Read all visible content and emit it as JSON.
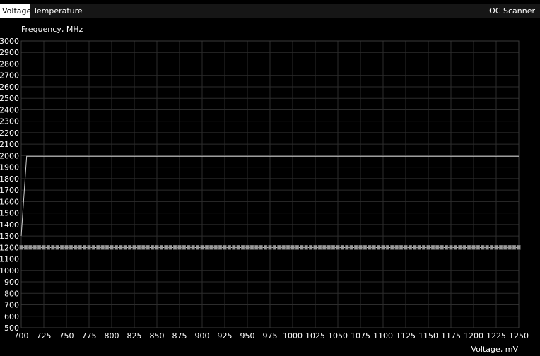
{
  "tabs": [
    {
      "label": "Voltage",
      "active": true
    },
    {
      "label": "Temperature",
      "active": false
    }
  ],
  "oc_scanner_label": "OC Scanner",
  "colors": {
    "background": "#000000",
    "grid": "#2c2c2c",
    "curve": "#cfcfcf",
    "marker": "#9a9a9a"
  },
  "chart_data": {
    "type": "line",
    "ylabel": "Frequency, MHz",
    "xlabel": "Voltage, mV",
    "xlim": [
      700,
      1250
    ],
    "ylim": [
      500,
      3000
    ],
    "x_ticks": [
      700,
      725,
      750,
      775,
      800,
      825,
      850,
      875,
      900,
      925,
      950,
      975,
      1000,
      1025,
      1050,
      1075,
      1100,
      1125,
      1150,
      1175,
      1200,
      1225,
      1250
    ],
    "y_ticks": [
      500,
      600,
      700,
      800,
      900,
      1000,
      1100,
      1200,
      1300,
      1400,
      1500,
      1600,
      1700,
      1800,
      1900,
      2000,
      2100,
      2200,
      2300,
      2400,
      2500,
      2600,
      2700,
      2800,
      2900,
      3000
    ],
    "grid": true,
    "series": [
      {
        "x": [
          700,
          706,
          1250
        ],
        "y": [
          1300,
          1995,
          1995
        ]
      },
      {
        "x": [
          700,
          705,
          710,
          715,
          720,
          725,
          730,
          735,
          740,
          745,
          750,
          755,
          760,
          765,
          770,
          775,
          780,
          785,
          790,
          795,
          800,
          805,
          810,
          815,
          820,
          825,
          830,
          835,
          840,
          845,
          850,
          855,
          860,
          865,
          870,
          875,
          880,
          885,
          890,
          895,
          900,
          905,
          910,
          915,
          920,
          925,
          930,
          935,
          940,
          945,
          950,
          955,
          960,
          965,
          970,
          975,
          980,
          985,
          990,
          995,
          1000,
          1005,
          1010,
          1015,
          1020,
          1025,
          1030,
          1035,
          1040,
          1045,
          1050,
          1055,
          1060,
          1065,
          1070,
          1075,
          1080,
          1085,
          1090,
          1095,
          1100,
          1105,
          1110,
          1115,
          1120,
          1125,
          1130,
          1135,
          1140,
          1145,
          1150,
          1155,
          1160,
          1165,
          1170,
          1175,
          1180,
          1185,
          1190,
          1195,
          1200,
          1205,
          1210,
          1215,
          1220,
          1225,
          1230,
          1235,
          1240,
          1245,
          1250
        ],
        "y": [
          1200,
          1200,
          1200,
          1200,
          1200,
          1200,
          1200,
          1200,
          1200,
          1200,
          1200,
          1200,
          1200,
          1200,
          1200,
          1200,
          1200,
          1200,
          1200,
          1200,
          1200,
          1200,
          1200,
          1200,
          1200,
          1200,
          1200,
          1200,
          1200,
          1200,
          1200,
          1200,
          1200,
          1200,
          1200,
          1200,
          1200,
          1200,
          1200,
          1200,
          1200,
          1200,
          1200,
          1200,
          1200,
          1200,
          1200,
          1200,
          1200,
          1200,
          1200,
          1200,
          1200,
          1200,
          1200,
          1200,
          1200,
          1200,
          1200,
          1200,
          1200,
          1200,
          1200,
          1200,
          1200,
          1200,
          1200,
          1200,
          1200,
          1200,
          1200,
          1200,
          1200,
          1200,
          1200,
          1200,
          1200,
          1200,
          1200,
          1200,
          1200,
          1200,
          1200,
          1200,
          1200,
          1200,
          1200,
          1200,
          1200,
          1200,
          1200,
          1200,
          1200,
          1200,
          1200,
          1200,
          1200,
          1200,
          1200,
          1200,
          1200,
          1200,
          1200,
          1200,
          1200,
          1200,
          1200,
          1200,
          1200,
          1200,
          1200
        ]
      }
    ]
  }
}
